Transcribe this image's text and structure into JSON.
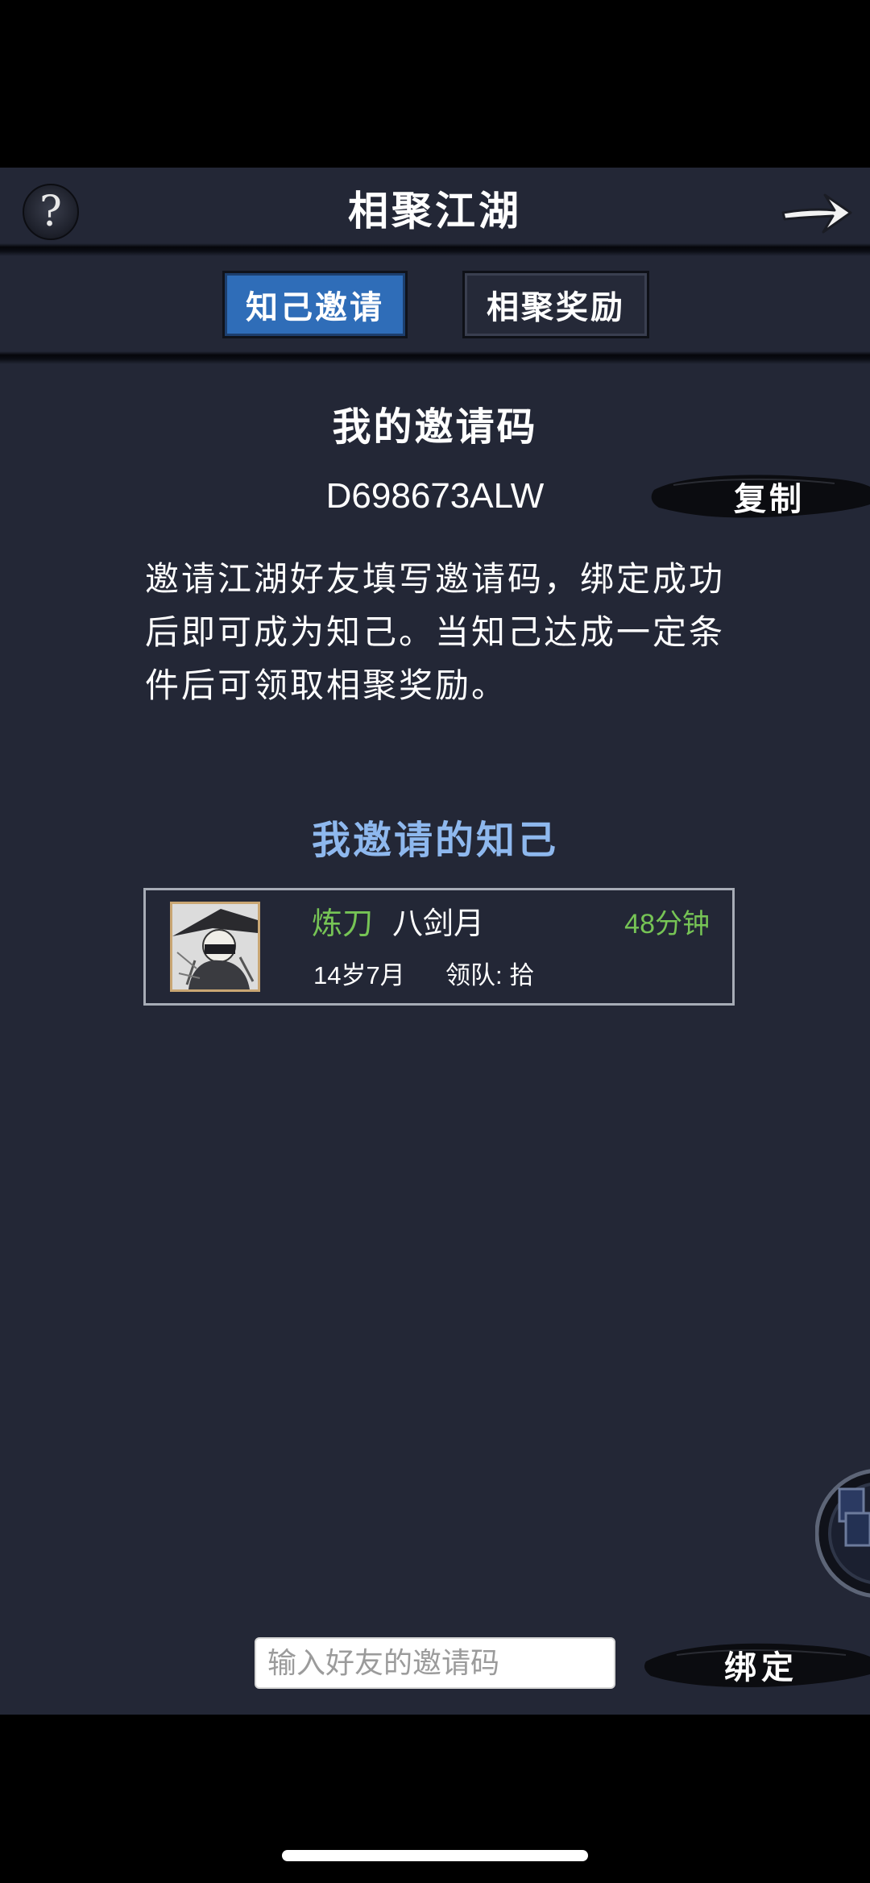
{
  "header": {
    "title": "相聚江湖",
    "help_label": "?"
  },
  "tabs": [
    {
      "label": "知己邀请",
      "active": true
    },
    {
      "label": "相聚奖励",
      "active": false
    }
  ],
  "my_code": {
    "heading": "我的邀请码",
    "code": "D698673ALW",
    "copy_label": "复制"
  },
  "description": "邀请江湖好友填写邀请码，绑定成功后即可成为知己。当知己达成一定条件后可领取相聚奖励。",
  "friends": {
    "heading": "我邀请的知己",
    "items": [
      {
        "prefix": "炼刀",
        "name": "八剑月",
        "time": "48分钟",
        "age": "14岁7月",
        "leader": "领队: 拾"
      }
    ]
  },
  "bind": {
    "placeholder": "输入好友的邀请码",
    "button_label": "绑定"
  },
  "colors": {
    "background": "#232736",
    "tab_active": "#2f6db8",
    "accent_green": "#76c455",
    "heading_blue": "#8eb8ee"
  }
}
